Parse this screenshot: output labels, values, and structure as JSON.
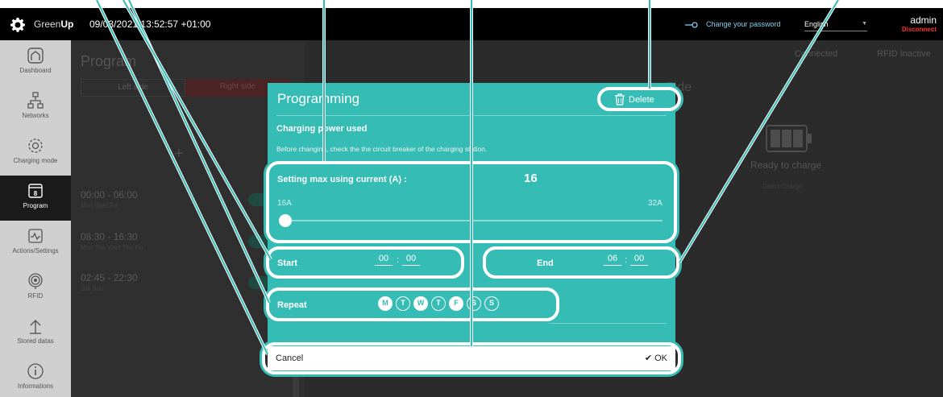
{
  "header": {
    "brand_prefix": "Green",
    "brand_suffix": "Up",
    "datetime": "09/03/2021 13:52:57 +01:00",
    "change_password": "Change your password",
    "language": "English",
    "username": "admin",
    "disconnect": "Disconnect"
  },
  "sidebar": {
    "items": [
      {
        "label": "Dashboard",
        "icon": "home-icon"
      },
      {
        "label": "Networks",
        "icon": "network-icon"
      },
      {
        "label": "Charging mode",
        "icon": "gear-icon"
      },
      {
        "label": "Program",
        "icon": "calendar-icon"
      },
      {
        "label": "Actions/Settings",
        "icon": "pulse-icon"
      },
      {
        "label": "RFID",
        "icon": "rfid-icon"
      },
      {
        "label": "Stored datas",
        "icon": "upload-arrow-icon"
      },
      {
        "label": "Informations",
        "icon": "info-icon"
      }
    ],
    "active_index": 3
  },
  "background": {
    "title": "Program",
    "tab_left": "Left side",
    "tab_right": "Right side",
    "slots": [
      {
        "time": "00:00 - 06:00",
        "days": "Mon Wed Fri"
      },
      {
        "time": "08:30 - 16:30",
        "days": "Mon Tue Wed Thu Fri"
      },
      {
        "time": "02:45 - 22:30",
        "days": "Sat Sun"
      }
    ],
    "right_title": "Side",
    "connected": "Connected",
    "rfid": "RFID Inactive",
    "status": "Ready to charge",
    "mode": "Direct Charge"
  },
  "dialog": {
    "title": "Programming",
    "delete_label": "Delete",
    "section_title": "Charging power used",
    "section_text": "Before changing, check the the circuit breaker of the charging station.",
    "current_label": "Setting max using current (A) :",
    "current_value": "16",
    "min_label": "16A",
    "max_label": "32A",
    "slider": {
      "min": 16,
      "max": 32,
      "value": 16
    },
    "start_label": "Start",
    "start_hour": "00",
    "start_min": "00",
    "end_label": "End",
    "end_hour": "06",
    "end_min": "00",
    "repeat_label": "Repeat",
    "days": [
      {
        "letter": "M",
        "on": true
      },
      {
        "letter": "T",
        "on": false
      },
      {
        "letter": "W",
        "on": true
      },
      {
        "letter": "T",
        "on": false
      },
      {
        "letter": "F",
        "on": true
      },
      {
        "letter": "S",
        "on": false
      },
      {
        "letter": "S",
        "on": false
      }
    ],
    "cancel_label": "Cancel",
    "ok_label": "OK"
  },
  "colors": {
    "dialog_bg": "#35bcb5",
    "header_bg": "#000000",
    "sidebar_bg": "#cfcfcf",
    "disconnect": "#ff3030",
    "annotation": "#ffffff"
  }
}
